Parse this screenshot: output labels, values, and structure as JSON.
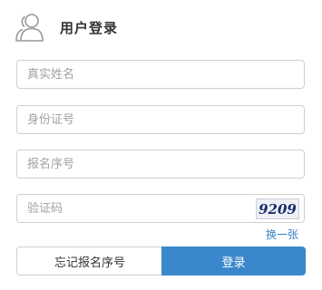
{
  "header": {
    "title": "用户登录",
    "icon": "users-icon"
  },
  "form": {
    "name_placeholder": "真实姓名",
    "id_placeholder": "身份证号",
    "regno_placeholder": "报名序号",
    "captcha_placeholder": "验证码",
    "captcha_text": "9209",
    "refresh_label": "换一张"
  },
  "actions": {
    "forgot_label": "忘记报名序号",
    "login_label": "登录"
  },
  "colors": {
    "accent": "#3a88cb",
    "link": "#3a7fc6"
  }
}
